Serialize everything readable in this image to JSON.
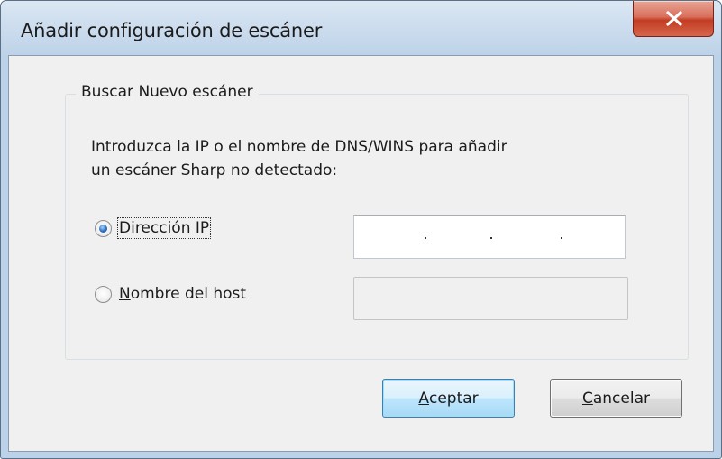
{
  "window": {
    "title": "Añadir configuración de escáner"
  },
  "group": {
    "legend": "Buscar Nuevo escáner",
    "instruction_line1": "Introduzca la IP o el nombre de DNS/WINS para  añadir",
    "instruction_line2": "un escáner Sharp no detectado:"
  },
  "options": {
    "ip": {
      "mnemonic": "D",
      "label_rest": "irección IP",
      "selected": true,
      "value": "   .   .   ."
    },
    "host": {
      "mnemonic": "N",
      "label_rest": "ombre del host",
      "selected": false,
      "value": ""
    }
  },
  "buttons": {
    "ok_mnemonic": "A",
    "ok_rest": "ceptar",
    "cancel_mnemonic": "C",
    "cancel_rest": "ancelar"
  },
  "icons": {
    "close": "close-icon"
  },
  "colors": {
    "close_button": "#c33c22",
    "primary_button_border": "#3c7fb1",
    "radio_selected": "#2c6fbf"
  }
}
